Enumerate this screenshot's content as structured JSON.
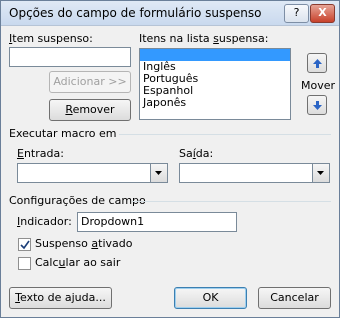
{
  "window": {
    "title": "Opções do campo de formulário suspenso",
    "help_glyph": "?",
    "close_glyph": "X"
  },
  "left": {
    "item_label_u": "I",
    "item_label_rest": "tem suspenso:",
    "item_value": "",
    "add_button": "Adicionar >>",
    "remove_button_u": "R",
    "remove_button_rest": "emover"
  },
  "list": {
    "label_pre": "Itens na lista ",
    "label_u": "s",
    "label_post": "uspensa:",
    "items": [
      "",
      "Inglês",
      "Português",
      "Espanhol",
      "Japonês"
    ],
    "selected_index": 0
  },
  "move": {
    "label": "Mover",
    "up_icon": "arrow-up-icon",
    "down_icon": "arrow-down-icon"
  },
  "macro": {
    "section_label": "Executar macro em",
    "entry_label_u": "E",
    "entry_label_rest": "ntrada:",
    "entry_value": "",
    "exit_label_pre": "Sa",
    "exit_label_u": "í",
    "exit_label_post": "da:",
    "exit_value": ""
  },
  "field_settings": {
    "section_label": "Configurações de campo",
    "indicator_label_u": "I",
    "indicator_label_rest": "ndicador:",
    "indicator_value": "Dropdown1",
    "dropdown_enabled_label_pre": "Suspenso ",
    "dropdown_enabled_label_u": "a",
    "dropdown_enabled_label_post": "tivado",
    "dropdown_enabled_checked": true,
    "calc_on_exit_label_pre": "Calc",
    "calc_on_exit_label_u": "u",
    "calc_on_exit_label_post": "lar ao sair",
    "calc_on_exit_checked": false
  },
  "footer": {
    "help_text_button_u": "T",
    "help_text_button_rest": "exto de ajuda...",
    "ok_button": "OK",
    "cancel_button": "Cancelar"
  }
}
